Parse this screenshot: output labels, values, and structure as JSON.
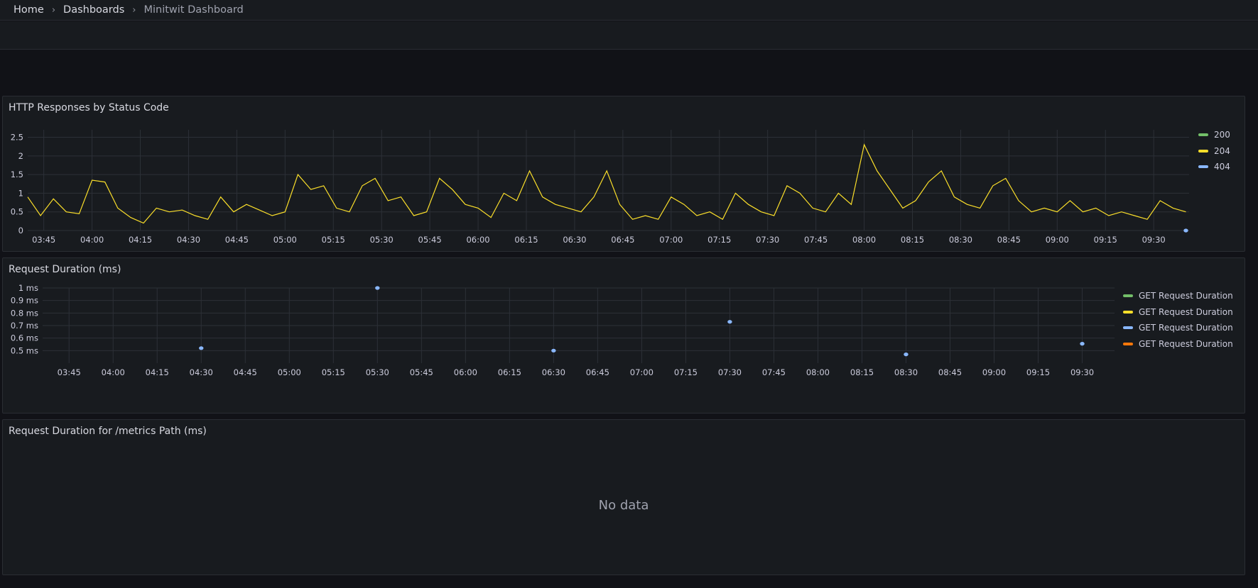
{
  "breadcrumb": {
    "home": "Home",
    "dashboards": "Dashboards",
    "current": "Minitwit Dashboard"
  },
  "panels": {
    "http": {
      "title": "HTTP Responses by Status Code"
    },
    "duration": {
      "title": "Request Duration (ms)"
    },
    "metrics": {
      "title": "Request Duration for /metrics Path (ms)",
      "empty_text": "No data"
    }
  },
  "colors": {
    "green": "#73bf69",
    "yellow": "#fade2a",
    "blue": "#8ab8ff",
    "orange": "#ff780a"
  },
  "chart_data": [
    {
      "type": "line",
      "title": "HTTP Responses by Status Code",
      "time_ticks": [
        "03:45",
        "04:00",
        "04:15",
        "04:30",
        "04:45",
        "05:00",
        "05:15",
        "05:30",
        "05:45",
        "06:00",
        "06:15",
        "06:30",
        "06:45",
        "07:00",
        "07:15",
        "07:30",
        "07:45",
        "08:00",
        "08:15",
        "08:30",
        "08:45",
        "09:00",
        "09:15",
        "09:30"
      ],
      "y_ticks": [
        "0",
        "0.5",
        "1",
        "1.5",
        "2",
        "2.5"
      ],
      "ylim": [
        0,
        2.7
      ],
      "x_range": [
        "03:40",
        "09:41"
      ],
      "legend_placement": "right",
      "series": [
        {
          "name": "200",
          "color": "#73bf69",
          "x": [],
          "y": []
        },
        {
          "name": "204",
          "color": "#fade2a",
          "x": [
            "03:40",
            "03:44",
            "03:48",
            "03:52",
            "03:56",
            "04:00",
            "04:04",
            "04:08",
            "04:12",
            "04:16",
            "04:20",
            "04:24",
            "04:28",
            "04:32",
            "04:36",
            "04:40",
            "04:44",
            "04:48",
            "04:52",
            "04:56",
            "05:00",
            "05:04",
            "05:08",
            "05:12",
            "05:16",
            "05:20",
            "05:24",
            "05:28",
            "05:32",
            "05:36",
            "05:40",
            "05:44",
            "05:48",
            "05:52",
            "05:56",
            "06:00",
            "06:04",
            "06:08",
            "06:12",
            "06:16",
            "06:20",
            "06:24",
            "06:28",
            "06:32",
            "06:36",
            "06:40",
            "06:44",
            "06:48",
            "06:52",
            "06:56",
            "07:00",
            "07:04",
            "07:08",
            "07:12",
            "07:16",
            "07:20",
            "07:24",
            "07:28",
            "07:32",
            "07:36",
            "07:40",
            "07:44",
            "07:48",
            "07:52",
            "07:56",
            "08:00",
            "08:04",
            "08:08",
            "08:12",
            "08:16",
            "08:20",
            "08:24",
            "08:28",
            "08:32",
            "08:36",
            "08:40",
            "08:44",
            "08:48",
            "08:52",
            "08:56",
            "09:00",
            "09:04",
            "09:08",
            "09:12",
            "09:16",
            "09:20",
            "09:24",
            "09:28",
            "09:32",
            "09:36",
            "09:40"
          ],
          "y": [
            0.9,
            0.4,
            0.85,
            0.5,
            0.45,
            1.35,
            1.3,
            0.6,
            0.35,
            0.2,
            0.6,
            0.5,
            0.55,
            0.4,
            0.3,
            0.9,
            0.5,
            0.7,
            0.55,
            0.4,
            0.5,
            1.5,
            1.1,
            1.2,
            0.6,
            0.5,
            1.2,
            1.4,
            0.8,
            0.9,
            0.4,
            0.5,
            1.4,
            1.1,
            0.7,
            0.6,
            0.35,
            1.0,
            0.8,
            1.6,
            0.9,
            0.7,
            0.6,
            0.5,
            0.9,
            1.6,
            0.7,
            0.3,
            0.4,
            0.3,
            0.9,
            0.7,
            0.4,
            0.5,
            0.3,
            1.0,
            0.7,
            0.5,
            0.4,
            1.2,
            1.0,
            0.6,
            0.5,
            1.0,
            0.7,
            2.3,
            1.6,
            1.1,
            0.6,
            0.8,
            1.3,
            1.6,
            0.9,
            0.7,
            0.6,
            1.2,
            1.4,
            0.8,
            0.5,
            0.6,
            0.5,
            0.8,
            0.5,
            0.6,
            0.4,
            0.5,
            0.4,
            0.3,
            0.8,
            0.6,
            0.5
          ]
        },
        {
          "name": "404",
          "color": "#8ab8ff",
          "x": [
            "09:40"
          ],
          "y": [
            0
          ]
        }
      ]
    },
    {
      "type": "scatter",
      "title": "Request Duration (ms)",
      "time_ticks": [
        "03:45",
        "04:00",
        "04:15",
        "04:30",
        "04:45",
        "05:00",
        "05:15",
        "05:30",
        "05:45",
        "06:00",
        "06:15",
        "06:30",
        "06:45",
        "07:00",
        "07:15",
        "07:30",
        "07:45",
        "08:00",
        "08:15",
        "08:30",
        "08:45",
        "09:00",
        "09:15",
        "09:30"
      ],
      "y_ticks": [
        "0.5 ms",
        "0.6 ms",
        "0.7 ms",
        "0.8 ms",
        "0.9 ms",
        "1 ms"
      ],
      "ylim": [
        0.4,
        1.0
      ],
      "x_range": [
        "03:36",
        "09:41"
      ],
      "legend_placement": "right",
      "series": [
        {
          "name": "GET Request Duration",
          "color": "#73bf69",
          "x": [],
          "y": []
        },
        {
          "name": "GET Request Duration",
          "color": "#fade2a",
          "x": [],
          "y": []
        },
        {
          "name": "GET Request Duration",
          "color": "#8ab8ff",
          "x": [
            "04:30",
            "05:30",
            "06:30",
            "07:30",
            "08:30",
            "09:30"
          ],
          "y": [
            0.52,
            1.0,
            0.5,
            0.73,
            0.47,
            0.555
          ]
        },
        {
          "name": "GET Request Duration",
          "color": "#ff780a",
          "x": [],
          "y": []
        }
      ]
    },
    {
      "type": "line",
      "title": "Request Duration for /metrics Path (ms)",
      "series": []
    }
  ]
}
